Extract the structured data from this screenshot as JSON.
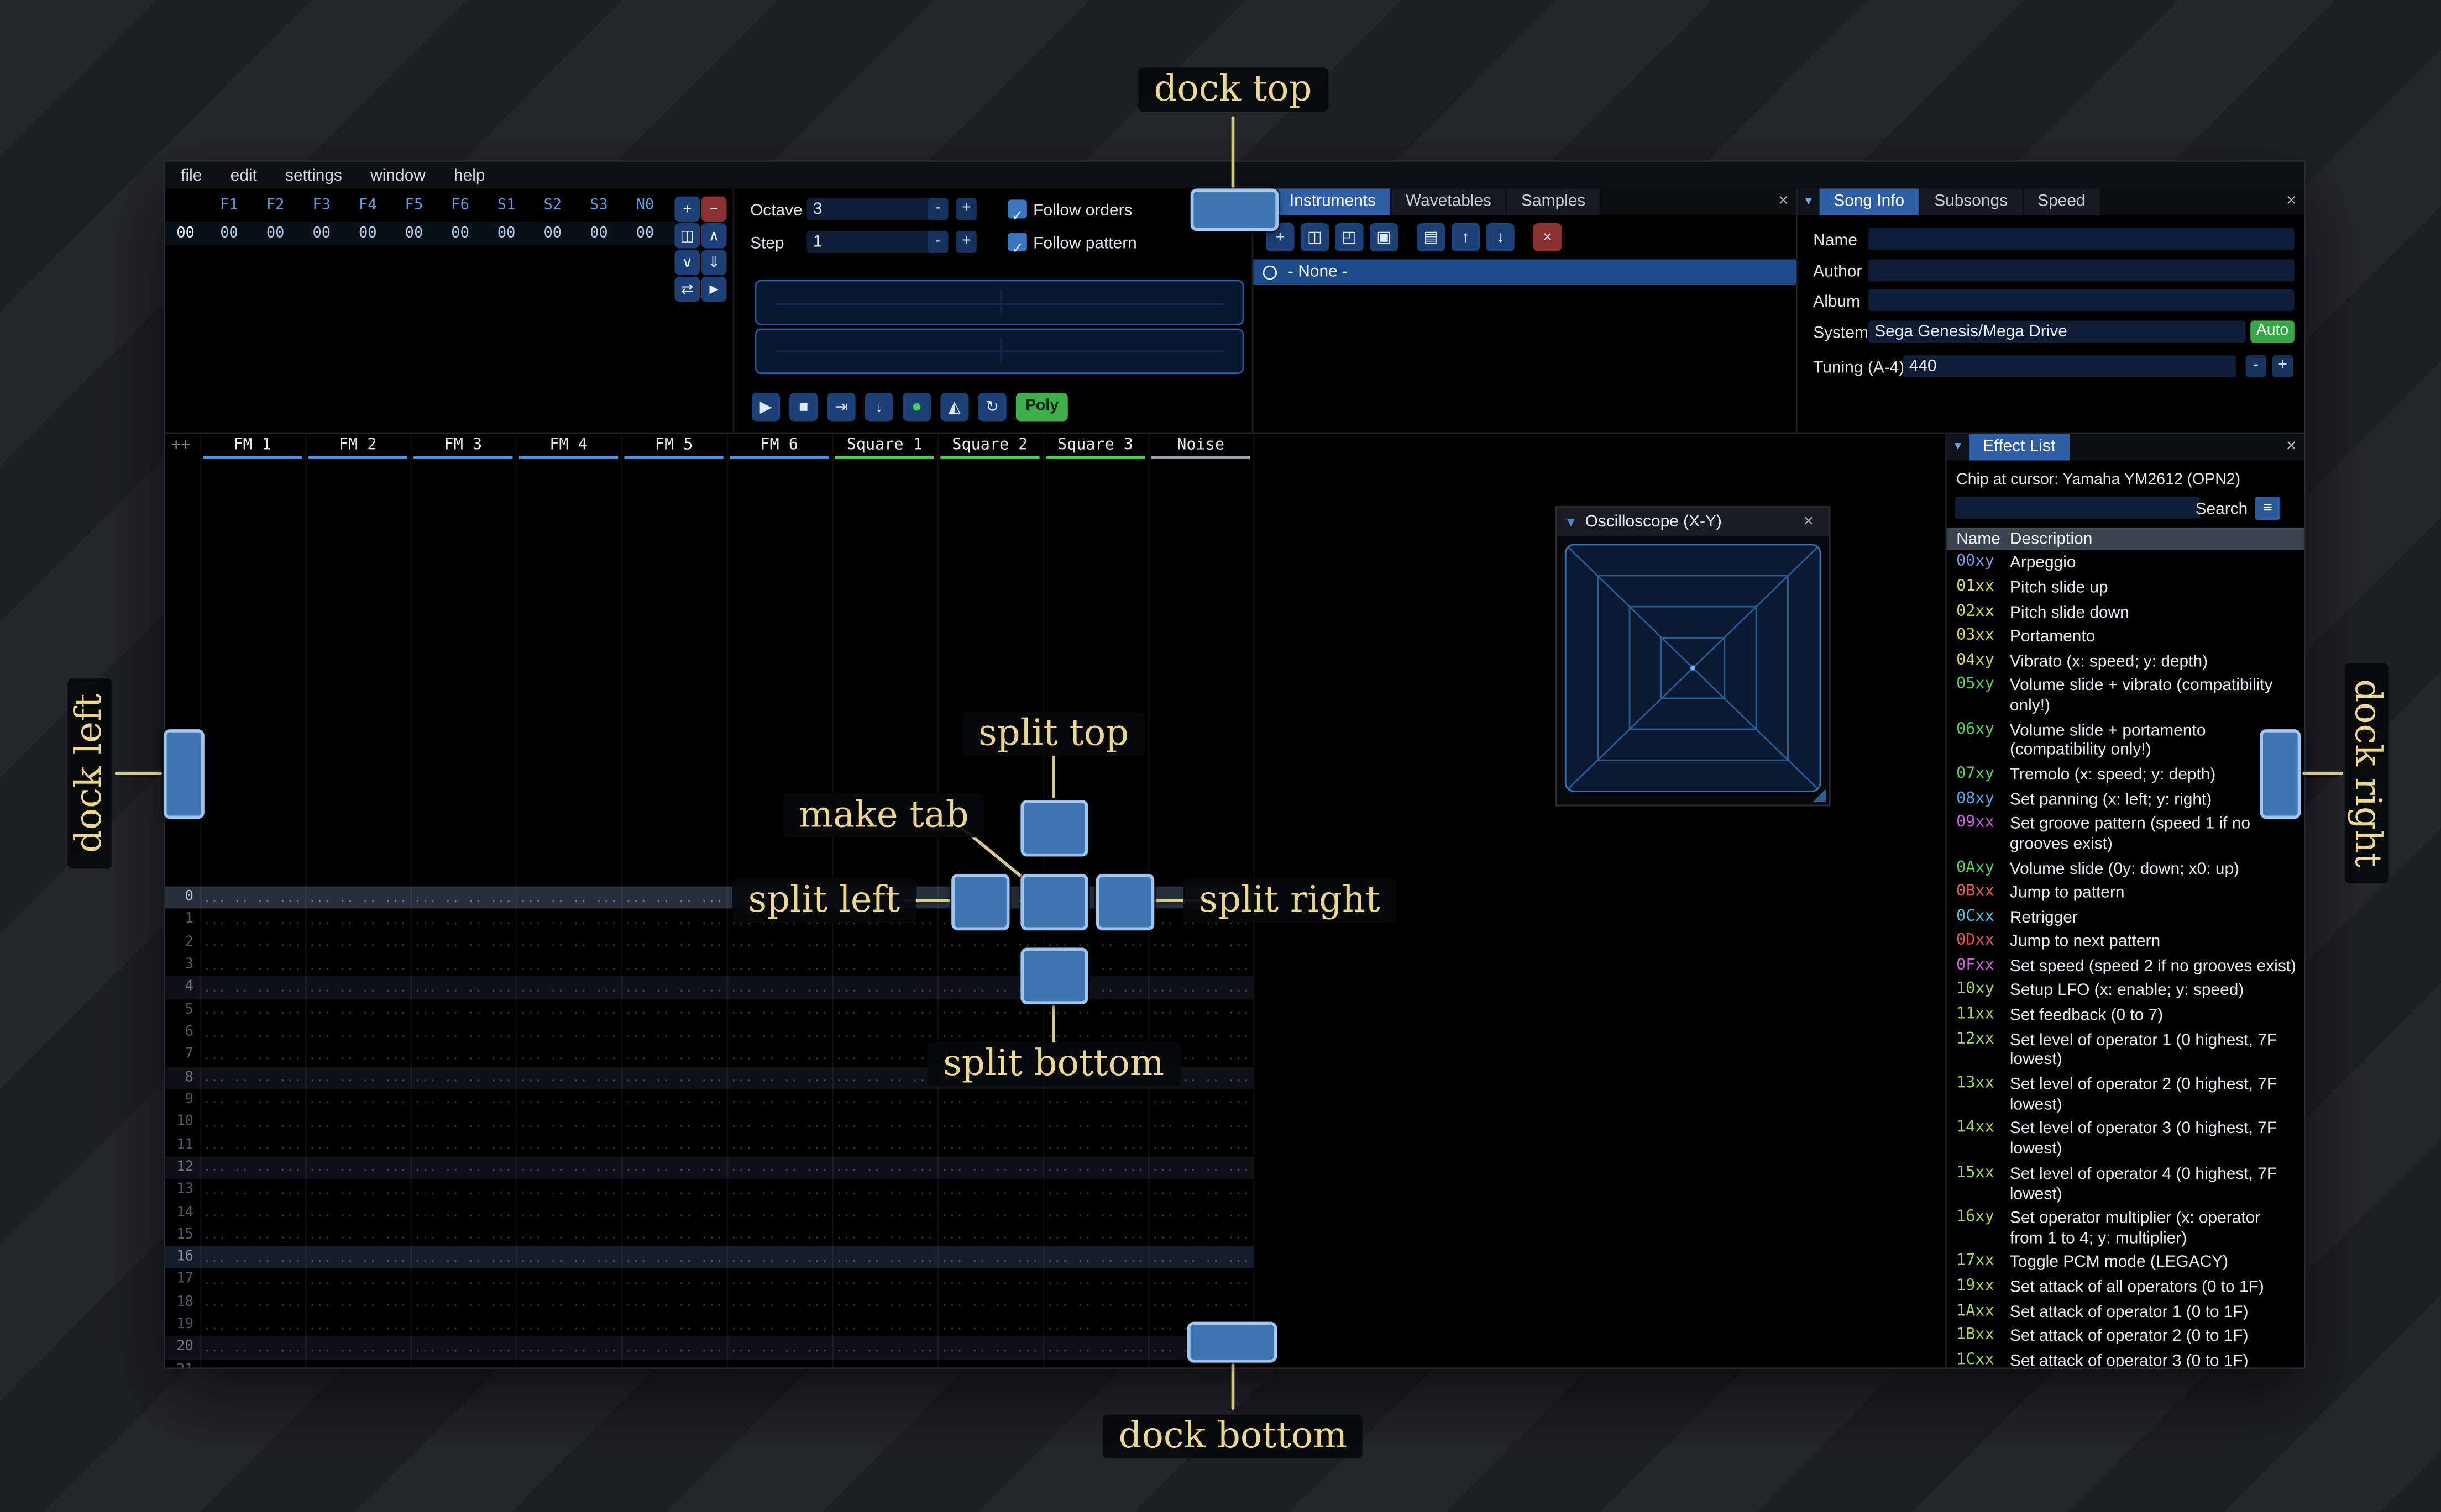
{
  "ui": {
    "close_glyph": "×",
    "collapse_glyph": "▼",
    "hamburger_glyph": "≡",
    "check_glyph": "✓",
    "minus_glyph": "-",
    "plus_glyph": "+"
  },
  "menu": {
    "items": [
      "file",
      "edit",
      "settings",
      "window",
      "help"
    ]
  },
  "orders": {
    "row_number": "00",
    "columns": [
      "F1",
      "F2",
      "F3",
      "F4",
      "F5",
      "F6",
      "S1",
      "S2",
      "S3",
      "N0"
    ],
    "values": [
      "00",
      "00",
      "00",
      "00",
      "00",
      "00",
      "00",
      "00",
      "00",
      "00"
    ],
    "toolbar": [
      {
        "name": "add-order-button",
        "icon": "plus-icon",
        "glyph": "+",
        "variant": "blue"
      },
      {
        "name": "remove-order-button",
        "icon": "minus-icon",
        "glyph": "−",
        "variant": "red"
      },
      {
        "name": "duplicate-order-button",
        "icon": "duplicate-icon",
        "glyph": "◫",
        "variant": "blue"
      },
      {
        "name": "move-order-up-button",
        "icon": "chevron-up-icon",
        "glyph": "∧",
        "variant": "blue"
      },
      {
        "name": "move-order-down-button",
        "icon": "chevron-down-icon",
        "glyph": "∨",
        "variant": "blue"
      },
      {
        "name": "duplicate-order-to-end-button",
        "icon": "double-arrow-down-icon",
        "glyph": "⇓",
        "variant": "blue"
      },
      {
        "name": "order-change-all-button",
        "icon": "swap-icon",
        "glyph": "⇄",
        "variant": "blue"
      },
      {
        "name": "order-edit-mode-button",
        "icon": "cursor-arrow-icon",
        "glyph": "►",
        "variant": "blue"
      }
    ]
  },
  "transport": {
    "octave_label": "Octave",
    "octave_value": "3",
    "step_label": "Step",
    "step_value": "1",
    "follow_orders_label": "Follow orders",
    "follow_pattern_label": "Follow pattern",
    "buttons": [
      {
        "name": "play-button",
        "icon": "play-icon",
        "glyph": "▶"
      },
      {
        "name": "stop-button",
        "icon": "stop-icon",
        "glyph": "■"
      },
      {
        "name": "play-pattern-button",
        "icon": "play-to-end-icon",
        "glyph": "⇥"
      },
      {
        "name": "step-one-row-button",
        "icon": "arrow-down-icon",
        "glyph": "↓"
      },
      {
        "name": "edit-record-toggle",
        "icon": "record-icon",
        "glyph": "●"
      },
      {
        "name": "metronome-toggle",
        "icon": "metronome-icon",
        "glyph": "◭"
      },
      {
        "name": "repeat-pattern-toggle",
        "icon": "repeat-icon",
        "glyph": "↻"
      }
    ],
    "poly_label": "Poly"
  },
  "instruments": {
    "tabs": [
      "Instruments",
      "Wavetables",
      "Samples"
    ],
    "active_tab": "Instruments",
    "toolbar": [
      {
        "name": "add-instrument-button",
        "icon": "plus-icon",
        "glyph": "+",
        "variant": "blue",
        "gap": false
      },
      {
        "name": "duplicate-instrument-button",
        "icon": "duplicate-icon",
        "glyph": "◫",
        "variant": "blue",
        "gap": false
      },
      {
        "name": "open-instrument-button",
        "icon": "folder-open-icon",
        "glyph": "◰",
        "variant": "blue",
        "gap": false
      },
      {
        "name": "save-instrument-button",
        "icon": "save-icon",
        "glyph": "▣",
        "variant": "blue",
        "gap": false
      },
      {
        "name": "instrument-folder-view-toggle",
        "icon": "folder-tree-icon",
        "glyph": "▤",
        "variant": "blue",
        "gap": true
      },
      {
        "name": "move-instrument-up-button",
        "icon": "arrow-up-icon",
        "glyph": "↑",
        "variant": "blue",
        "gap": false
      },
      {
        "name": "move-instrument-down-button",
        "icon": "arrow-down-icon",
        "glyph": "↓",
        "variant": "blue",
        "gap": false
      },
      {
        "name": "delete-instrument-button",
        "icon": "delete-x-icon",
        "glyph": "×",
        "variant": "red",
        "gap": true
      }
    ],
    "list_item": "- None -"
  },
  "song_info": {
    "tabs": [
      "Song Info",
      "Subsongs",
      "Speed"
    ],
    "active_tab": "Song Info",
    "name_label": "Name",
    "name_value": "",
    "author_label": "Author",
    "author_value": "",
    "album_label": "Album",
    "album_value": "",
    "system_label": "System",
    "system_value": "Sega Genesis/Mega Drive",
    "auto_label": "Auto",
    "tuning_label": "Tuning (A-4)",
    "tuning_value": "440"
  },
  "pattern": {
    "corner_label": "++",
    "channels": [
      {
        "label": "FM 1",
        "color": "#4a90d9"
      },
      {
        "label": "FM 2",
        "color": "#4a90d9"
      },
      {
        "label": "FM 3",
        "color": "#4a90d9"
      },
      {
        "label": "FM 4",
        "color": "#4a90d9"
      },
      {
        "label": "FM 5",
        "color": "#4a90d9"
      },
      {
        "label": "FM 6",
        "color": "#4a90d9"
      },
      {
        "label": "Square 1",
        "color": "#45c94f"
      },
      {
        "label": "Square 2",
        "color": "#45c94f"
      },
      {
        "label": "Square 3",
        "color": "#45c94f"
      },
      {
        "label": "Noise",
        "color": "#9aa0a6"
      }
    ],
    "row_count": 22,
    "empty_cell": "... .. .. ..."
  },
  "oscilloscope": {
    "title": "Oscilloscope (X-Y)"
  },
  "effect_list": {
    "title": "Effect List",
    "chip_line": "Chip at cursor: Yamaha YM2612 (OPN2)",
    "search_label": "Search",
    "search_value": "",
    "columns": {
      "name": "Name",
      "description": "Description"
    },
    "effects": [
      {
        "code": "00xy",
        "desc": "Arpeggio",
        "color": "#7b9ce6"
      },
      {
        "code": "01xx",
        "desc": "Pitch slide up",
        "color": "#d9d94f"
      },
      {
        "code": "02xx",
        "desc": "Pitch slide down",
        "color": "#d9d94f"
      },
      {
        "code": "03xx",
        "desc": "Portamento",
        "color": "#d9d94f"
      },
      {
        "code": "04xy",
        "desc": "Vibrato (x: speed; y: depth)",
        "color": "#d9d94f"
      },
      {
        "code": "05xy",
        "desc": "Volume slide + vibrato (compatibility only!)",
        "color": "#52d452"
      },
      {
        "code": "06xy",
        "desc": "Volume slide + portamento (compatibility only!)",
        "color": "#52d452"
      },
      {
        "code": "07xy",
        "desc": "Tremolo (x: speed; y: depth)",
        "color": "#52d452"
      },
      {
        "code": "08xy",
        "desc": "Set panning (x: left; y: right)",
        "color": "#4fa6e8"
      },
      {
        "code": "09xx",
        "desc": "Set groove pattern (speed 1 if no grooves exist)",
        "color": "#cf5fe0"
      },
      {
        "code": "0Axy",
        "desc": "Volume slide (0y: down; x0: up)",
        "color": "#52d452"
      },
      {
        "code": "0Bxx",
        "desc": "Jump to pattern",
        "color": "#e85a4f"
      },
      {
        "code": "0Cxx",
        "desc": "Retrigger",
        "color": "#4fc9e0"
      },
      {
        "code": "0Dxx",
        "desc": "Jump to next pattern",
        "color": "#e85a4f"
      },
      {
        "code": "0Fxx",
        "desc": "Set speed (speed 2 if no grooves exist)",
        "color": "#cf5fe0"
      },
      {
        "code": "10xy",
        "desc": "Setup LFO (x: enable; y: speed)",
        "color": "#a9d94f"
      },
      {
        "code": "11xx",
        "desc": "Set feedback (0 to 7)",
        "color": "#a9d94f"
      },
      {
        "code": "12xx",
        "desc": "Set level of operator 1 (0 highest, 7F lowest)",
        "color": "#a9d94f"
      },
      {
        "code": "13xx",
        "desc": "Set level of operator 2 (0 highest, 7F lowest)",
        "color": "#a9d94f"
      },
      {
        "code": "14xx",
        "desc": "Set level of operator 3 (0 highest, 7F lowest)",
        "color": "#a9d94f"
      },
      {
        "code": "15xx",
        "desc": "Set level of operator 4 (0 highest, 7F lowest)",
        "color": "#a9d94f"
      },
      {
        "code": "16xy",
        "desc": "Set operator multiplier (x: operator from 1 to 4; y: multiplier)",
        "color": "#a9d94f"
      },
      {
        "code": "17xx",
        "desc": "Toggle PCM mode (LEGACY)",
        "color": "#a9d94f"
      },
      {
        "code": "19xx",
        "desc": "Set attack of all operators (0 to 1F)",
        "color": "#a9d94f"
      },
      {
        "code": "1Axx",
        "desc": "Set attack of operator 1 (0 to 1F)",
        "color": "#a9d94f"
      },
      {
        "code": "1Bxx",
        "desc": "Set attack of operator 2 (0 to 1F)",
        "color": "#a9d94f"
      },
      {
        "code": "1Cxx",
        "desc": "Set attack of operator 3 (0 to 1F)",
        "color": "#a9d94f"
      }
    ]
  },
  "dock_overlay": {
    "dock_top": "dock top",
    "dock_left": "dock left",
    "dock_right": "dock right",
    "dock_bottom": "dock bottom",
    "split_top": "split top",
    "split_left": "split left",
    "split_right": "split right",
    "split_bottom": "split bottom",
    "make_tab": "make tab"
  }
}
